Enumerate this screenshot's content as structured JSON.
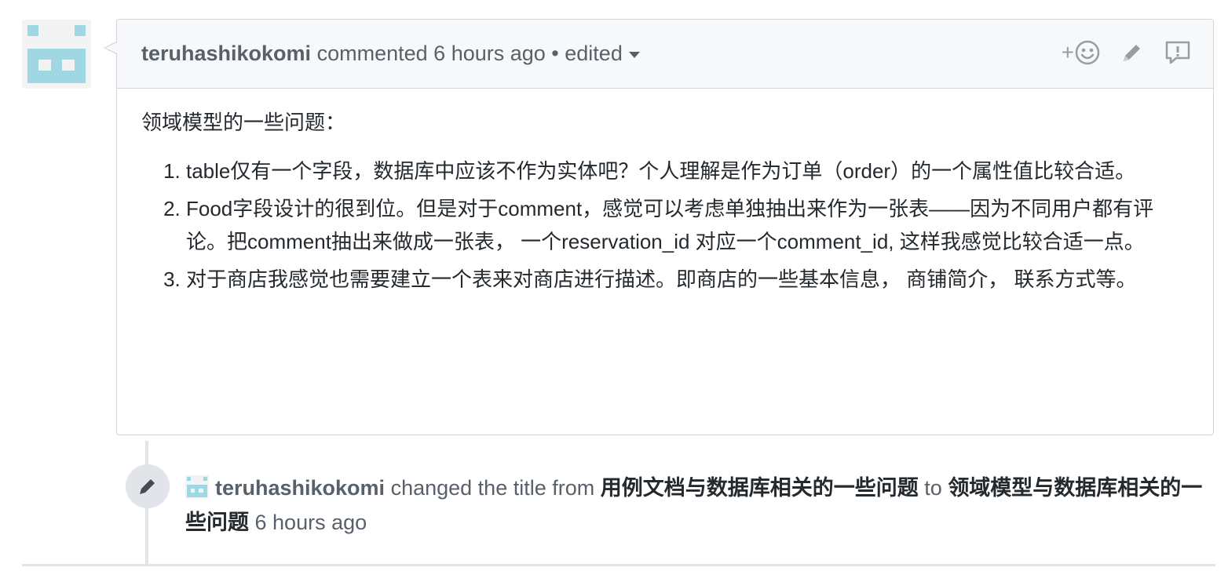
{
  "comment": {
    "author": "teruhashikokomi",
    "action": "commented",
    "time": "6 hours ago",
    "separator": "•",
    "edited_label": "edited",
    "add_reaction_label": "+",
    "intro": "领域模型的一些问题：",
    "items": [
      "table仅有一个字段，数据库中应该不作为实体吧？个人理解是作为订单（order）的一个属性值比较合适。",
      "Food字段设计的很到位。但是对于comment，感觉可以考虑单独抽出来作为一张表——因为不同用户都有评论。把comment抽出来做成一张表， 一个reservation_id 对应一个comment_id, 这样我感觉比较合适一点。",
      "对于商店我感觉也需要建立一个表来对商店进行描述。即商店的一些基本信息， 商铺简介， 联系方式等。"
    ]
  },
  "event": {
    "actor": "teruhashikokomi",
    "text": "changed the title from",
    "old_title": "用例文档与数据库相关的一些问题",
    "to_label": "to",
    "new_title": "领域模型与数据库相关的一些问题",
    "time": "6 hours ago"
  },
  "icons": {
    "avatar": "identicon-avatar",
    "reaction": "smiley-icon",
    "edit": "pencil-icon",
    "report": "report-icon",
    "event": "pencil-icon"
  },
  "colors": {
    "identicon": "#9fd7e3",
    "header_bg": "#f6f8fa",
    "border": "#d1d5da"
  }
}
